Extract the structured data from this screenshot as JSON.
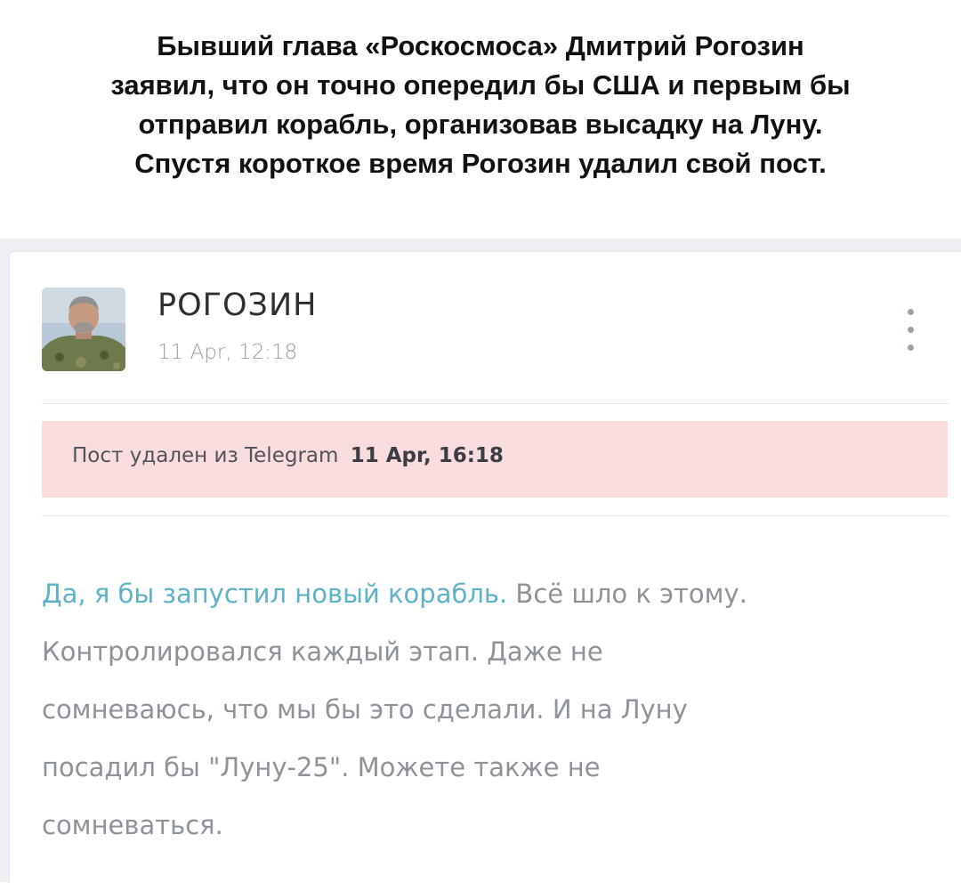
{
  "caption": {
    "lines": [
      "Бывший глава «Роскосмоса» Дмитрий Рогозин",
      "заявил, что он точно опередил бы США и первым бы",
      "отправил корабль, организовав высадку на Луну.",
      "Спустя короткое время Рогозин удалил свой пост."
    ]
  },
  "post": {
    "author": "РОГОЗИН",
    "timestamp": "11 Apr, 12:18",
    "menu_icon": "more-vertical-icon",
    "deleted_notice": {
      "text": "Пост удален из Telegram",
      "date": "11 Apr, 16:18",
      "background": "#f9dcdd"
    },
    "body": {
      "link_text": "Да, я бы запустил новый корабль.",
      "line1_rest": " Всё шло к этому.",
      "line2": "Контролировался каждый этап. Даже не",
      "line3": "сомневаюсь, что мы бы это сделали. И на Луну",
      "line4": "посадил бы \"Луну-25\". Можете также не",
      "line5": "сомневаться."
    }
  },
  "colors": {
    "link": "#5fb3c9",
    "body_text": "#8e9399",
    "author_text": "#2e2e33",
    "caption_text": "#111111"
  }
}
